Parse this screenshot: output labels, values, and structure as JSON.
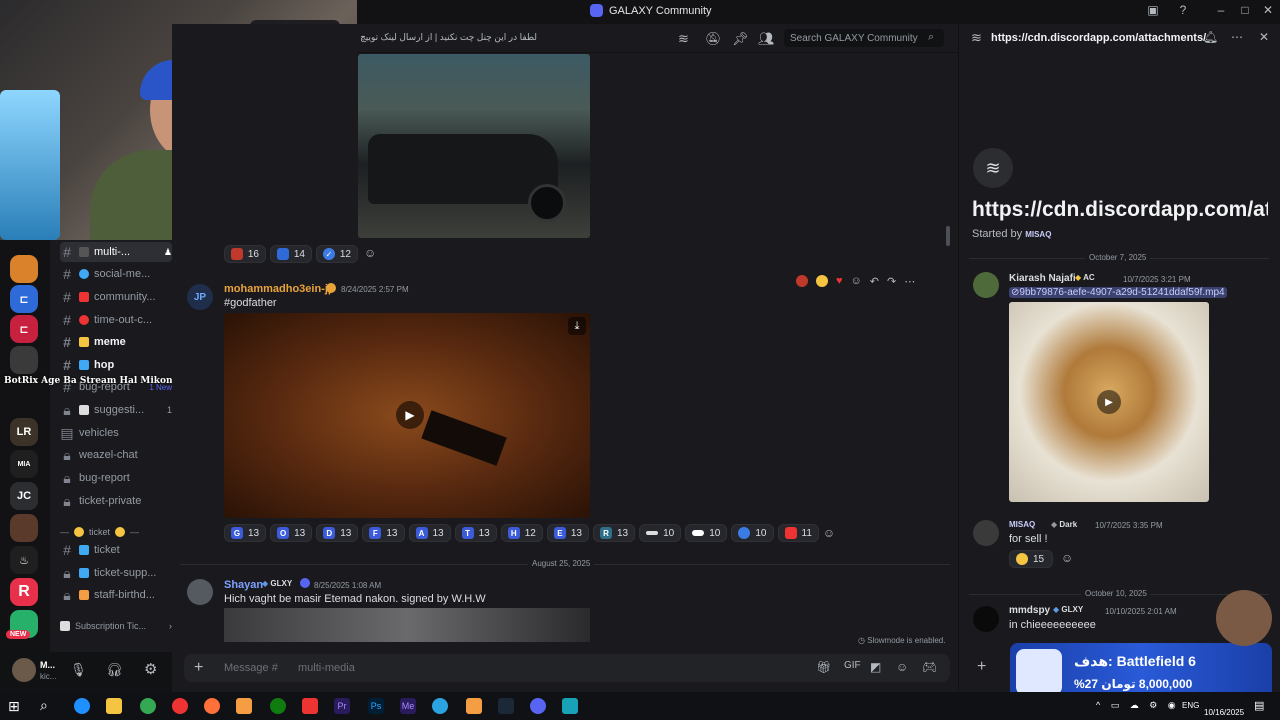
{
  "window": {
    "title": "GALAXY Community"
  },
  "overlay": {
    "label": "NEW",
    "stream_text": "BotRix  Age Ba Stream Hal Mikoni Baraye Hemaya"
  },
  "channels": [
    {
      "name": "multi-...",
      "active": true
    },
    {
      "name": "social-me..."
    },
    {
      "name": "community..."
    },
    {
      "name": "time-out-c..."
    },
    {
      "name": "meme",
      "bold": true
    },
    {
      "name": "hop",
      "bold": true
    },
    {
      "name": "bug-report",
      "badge": "1 New"
    },
    {
      "name": "suggesti...",
      "count": "1"
    },
    {
      "name": "vehicles"
    },
    {
      "name": "weazel-chat"
    },
    {
      "name": "bug-report"
    },
    {
      "name": "ticket-private"
    }
  ],
  "channel_category": "ticket",
  "channels2": [
    {
      "name": "ticket"
    },
    {
      "name": "ticket-supp..."
    },
    {
      "name": "staff-birthd..."
    },
    {
      "name": "Subscription Tic..."
    }
  ],
  "user": {
    "name": "M...",
    "status": "kic..."
  },
  "header": {
    "channel_topic": "لطفا در این چنل چت نکنید | از ارسال لینک توییچ، یوتیوب",
    "search_placeholder": "Search GALAXY Community"
  },
  "messages": {
    "reactions_top": [
      {
        "count": "16"
      },
      {
        "count": "14"
      },
      {
        "count": "12"
      }
    ],
    "msg1": {
      "author": "mohammadho3ein-jp",
      "avatar_text": "JP",
      "time": "8/24/2025 2:57 PM",
      "text": "#godfather"
    },
    "reactions_mid": [
      {
        "letter": "G",
        "count": "13",
        "color": "#3b5bdb"
      },
      {
        "letter": "O",
        "count": "13",
        "color": "#3b5bdb"
      },
      {
        "letter": "D",
        "count": "13",
        "color": "#3b5bdb"
      },
      {
        "letter": "F",
        "count": "13",
        "color": "#3b5bdb"
      },
      {
        "letter": "A",
        "count": "13",
        "color": "#3b5bdb"
      },
      {
        "letter": "T",
        "count": "13",
        "color": "#3b5bdb"
      },
      {
        "letter": "H",
        "count": "12",
        "color": "#3b5bdb"
      },
      {
        "letter": "E",
        "count": "13",
        "color": "#3b5bdb"
      },
      {
        "letter": "R",
        "count": "13",
        "color": "#2f6f8a"
      },
      {
        "letter": "",
        "count": "10",
        "color": "#26272d"
      },
      {
        "letter": "",
        "count": "10",
        "color": "#26272d"
      },
      {
        "letter": "",
        "count": "10",
        "color": "#26272d"
      },
      {
        "letter": "",
        "count": "11",
        "color": "#26272d"
      }
    ],
    "date_divider": "August 25, 2025",
    "msg2": {
      "author": "Shayan",
      "tag": "GLXY",
      "time": "8/25/2025 1:08 AM",
      "text": "Hich vaght be masir Etemad nakon. signed by W.H.W"
    },
    "slowmode": "Slowmode is enabled.",
    "composer_placeholder": "Message #",
    "composer_channel": "multi-media"
  },
  "thread": {
    "header_url": "https://cdn.discordapp.com/attachments/",
    "title": "https://cdn.discordapp.com/att",
    "started_by_label": "Started by",
    "started_by_user": "MISAQ",
    "date1": "October 7, 2025",
    "m1": {
      "author": "Kiarash Najafi",
      "tag": "AC",
      "time": "10/7/2025 3:21 PM",
      "link": "9bb79876-aefe-4907-a29d-51241ddaf59f.mp4"
    },
    "m2": {
      "author": "MISAQ",
      "tag": "Dark",
      "time": "10/7/2025 3:35 PM",
      "text": "for sell !",
      "reaction_count": "15"
    },
    "date2": "October 10, 2025",
    "m3": {
      "author": "mmdspy",
      "tag": "GLXY",
      "time": "10/10/2025 2:01 AM",
      "text": "in chieeeeeeeeee"
    },
    "promo_title": "Battlefield 6 :هدف",
    "promo_sub": "8,000,000 تومان  27%"
  },
  "taskbar": {
    "lang": "ENG",
    "time": "",
    "date": "10/16/2025"
  },
  "colors": {
    "accent": "#5865f2",
    "link": "#00a8fc",
    "mention": "#c9cdfb"
  }
}
